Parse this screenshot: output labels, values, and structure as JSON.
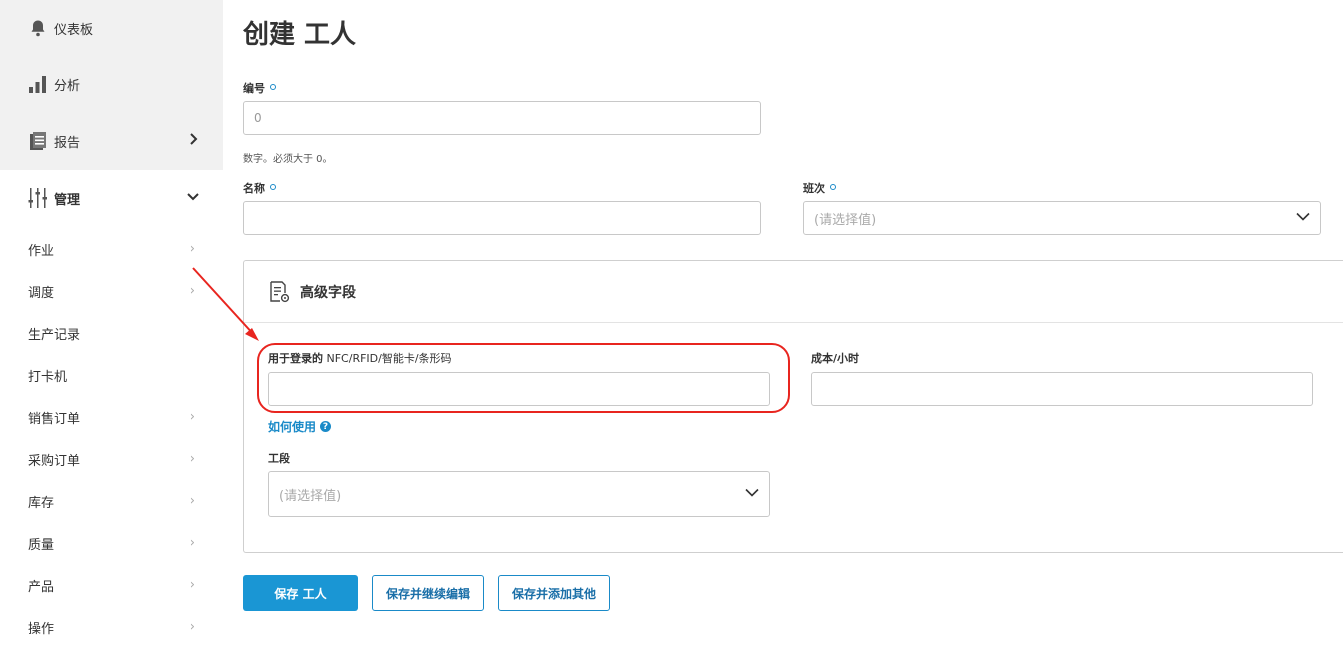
{
  "sidebar": {
    "top_items": [
      {
        "label": "仪表板",
        "icon": "bell-icon"
      },
      {
        "label": "分析",
        "icon": "bar-chart-icon"
      },
      {
        "label": "报告",
        "icon": "report-icon"
      },
      {
        "label": "管理",
        "icon": "sliders-icon"
      }
    ],
    "sub_items": [
      {
        "label": "作业"
      },
      {
        "label": "调度"
      },
      {
        "label": "生产记录"
      },
      {
        "label": "打卡机"
      },
      {
        "label": "销售订单"
      },
      {
        "label": "采购订单"
      },
      {
        "label": "库存"
      },
      {
        "label": "质量"
      },
      {
        "label": "产品"
      },
      {
        "label": "操作"
      }
    ]
  },
  "page": {
    "title": "创建 工人"
  },
  "form": {
    "number": {
      "label": "编号",
      "value": "0",
      "hint": "数字。必须大于 0。"
    },
    "name": {
      "label": "名称",
      "value": ""
    },
    "shift": {
      "label": "班次",
      "placeholder": "(请选择值)"
    },
    "advanced": {
      "title": "高级字段",
      "nfc": {
        "label_prefix": "用于登录的",
        "label_suffix": "NFC/RFID/智能卡/条形码",
        "value": ""
      },
      "how_to": "如何使用",
      "cost": {
        "label": "成本/小时",
        "value": ""
      },
      "section": {
        "label": "工段",
        "placeholder": "(请选择值)"
      }
    }
  },
  "actions": {
    "save": "保存 工人",
    "save_continue": "保存并继续编辑",
    "save_add": "保存并添加其他"
  },
  "colors": {
    "accent": "#1a96d4",
    "highlight": "#e8251f"
  }
}
